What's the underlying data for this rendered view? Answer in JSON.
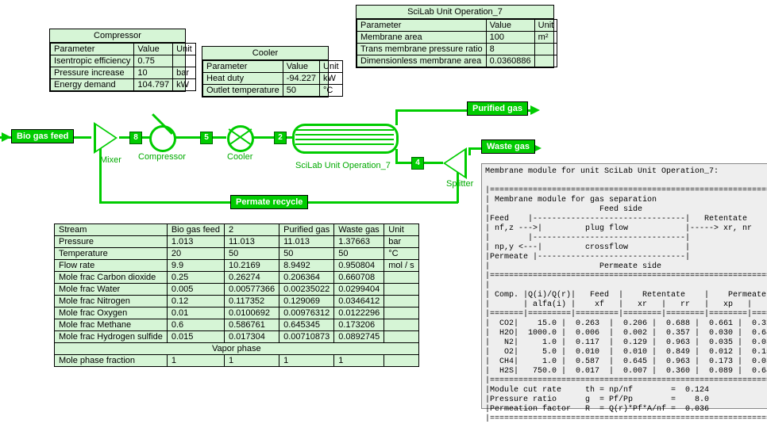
{
  "compressor_panel": {
    "title": "Compressor",
    "headers": [
      "Parameter",
      "Value",
      "Unit"
    ],
    "rows": [
      [
        "Isentropic efficiency",
        "0.75",
        ""
      ],
      [
        "Pressure increase",
        "10",
        "bar"
      ],
      [
        "Energy demand",
        "104.797",
        "kW"
      ]
    ]
  },
  "cooler_panel": {
    "title": "Cooler",
    "headers": [
      "Parameter",
      "Value",
      "Unit"
    ],
    "rows": [
      [
        "Heat duty",
        "-94.227",
        "kW"
      ],
      [
        "Outlet temperature",
        "50",
        "°C"
      ]
    ]
  },
  "scilab_panel": {
    "title": "SciLab Unit Operation_7",
    "headers": [
      "Parameter",
      "Value",
      "Unit"
    ],
    "rows": [
      [
        "Membrane area",
        "100",
        "m²"
      ],
      [
        "Trans membrane pressure ratio",
        "8",
        ""
      ],
      [
        "Dimensionless membrane area",
        "0.0360886",
        ""
      ]
    ]
  },
  "stream_labels": {
    "feed": "Bio gas feed",
    "purified": "Purified gas",
    "waste": "Waste gas",
    "recycle": "Permate recycle"
  },
  "block_labels": {
    "mixer": "Mixer",
    "compressor": "Compressor",
    "cooler": "Cooler",
    "scilab": "SciLab Unit Operation_7",
    "splitter": "Splitter"
  },
  "stream_numbers": {
    "n8": "8",
    "n5": "5",
    "n2": "2",
    "n4": "4"
  },
  "stream_table": {
    "headers": [
      "Stream",
      "Bio gas feed",
      "2",
      "Purified gas",
      "Waste gas",
      "Unit"
    ],
    "rows": [
      [
        "Pressure",
        "1.013",
        "11.013",
        "11.013",
        "1.37663",
        "bar"
      ],
      [
        "Temperature",
        "20",
        "50",
        "50",
        "50",
        "°C"
      ],
      [
        "Flow rate",
        "9.9",
        "10.2169",
        "8.9492",
        "0.950804",
        "mol / s"
      ],
      [
        "Mole frac Carbon dioxide",
        "0.25",
        "0.26274",
        "0.206364",
        "0.660708",
        ""
      ],
      [
        "Mole frac Water",
        "0.005",
        "0.00577366",
        "0.00235022",
        "0.0299404",
        ""
      ],
      [
        "Mole frac Nitrogen",
        "0.12",
        "0.117352",
        "0.129069",
        "0.0346412",
        ""
      ],
      [
        "Mole frac Oxygen",
        "0.01",
        "0.0100692",
        "0.00976312",
        "0.0122296",
        ""
      ],
      [
        "Mole frac Methane",
        "0.6",
        "0.586761",
        "0.645345",
        "0.173206",
        ""
      ],
      [
        "Mole frac Hydrogen sulfide",
        "0.015",
        "0.017304",
        "0.00710873",
        "0.0892745",
        ""
      ]
    ],
    "vapor_heading": "Vapor phase",
    "vapor_row": [
      "Mole phase fraction",
      "1",
      "1",
      "1",
      "1",
      ""
    ]
  },
  "console_title": "Membrane module for unit SciLab Unit Operation_7:",
  "console_body": "|===============================================================|\n| Membrane module for gas separation                            |\n|                       Feed side                               |\n|Feed    |--------------------------------|   Retentate         |\n| nf,z --->|         plug flow            |-----> xr, nr        |\n|        |--------------------------------|                     |\n| np,y <---|         crossflow            |                     |\n|Permeate |-------------------------------|                     |\n|                       Permeate side                           |\n|===============================================================|\n|                                                               |\n| Comp. |Q(i)/Q(r)|   Feed  |    Retentate    |    Permeate     |\n|       | alfa(i) |    xf   |   xr   |   rr   |   xp   |   rp   |\n|=======|=========|=========|========|========|========|========|\n|  CO2|    15.0 |  0.263  |  0.206 |  0.688 |  0.661 |  0.312 |\n|  H2O|  1000.0 |  0.006  |  0.002 |  0.357 |  0.030 |  0.643 |\n|   N2|     1.0 |  0.117  |  0.129 |  0.963 |  0.035 |  0.037 |\n|   O2|     5.0 |  0.010  |  0.010 |  0.849 |  0.012 |  0.151 |\n|  CH4|     1.0 |  0.587  |  0.645 |  0.963 |  0.173 |  0.037 |\n|  H2S|   750.0 |  0.017  |  0.007 |  0.360 |  0.089 |  0.640 |\n|===============================================================|\n|Module cut rate     th = np/nf        =  0.124                 |\n|Pressure ratio      g  = Pf/Pp        =    8.0                 |\n|Permeation factor   R  = Q(r)*Pf*A/nf =  0.036                 |\n|===============================================================|"
}
